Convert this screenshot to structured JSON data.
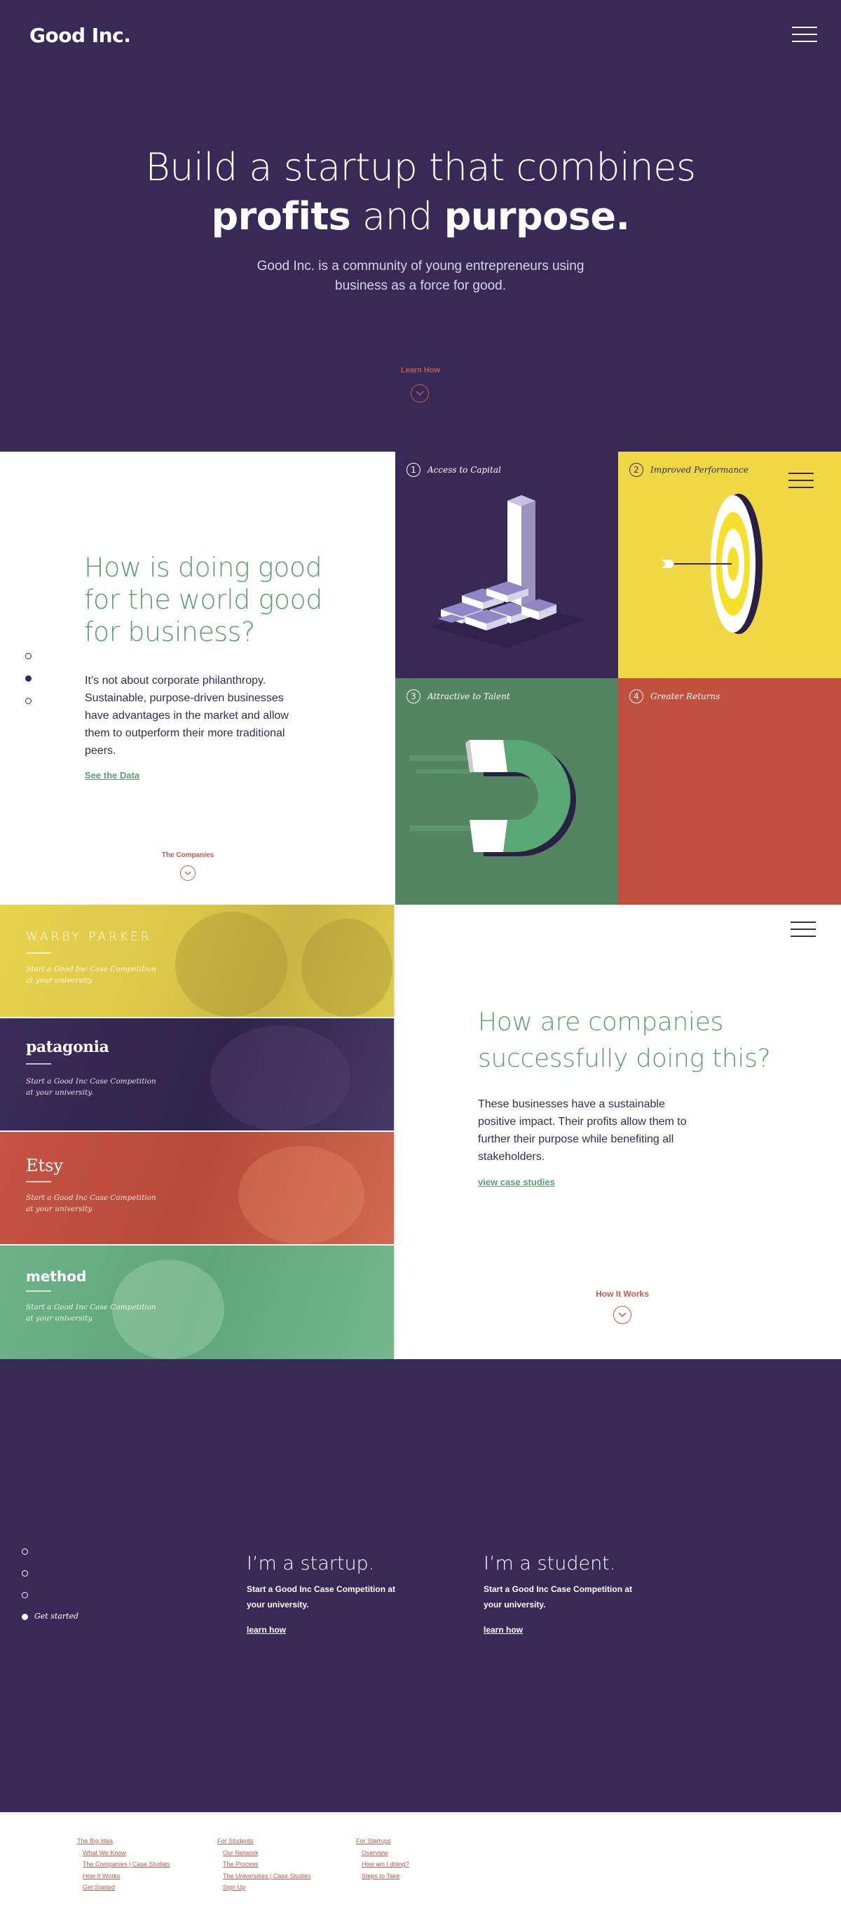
{
  "brand": {
    "logo": "Good Inc."
  },
  "colors": {
    "purple": "#372a57",
    "green": "#5a9f72",
    "yellow": "#f0d744",
    "red": "#c25040",
    "coral": "#c25a48"
  },
  "hero": {
    "title_line1": "Build a startup that combines",
    "title_strong1": "profits",
    "title_mid": "and",
    "title_strong2": "purpose.",
    "subtitle": "Good Inc. is a community of young entrepreneurs using business as a force for good.",
    "cta": "Learn How"
  },
  "why": {
    "title": "How is doing good for the world good for business?",
    "body": "It’s not about corporate philanthropy. Sustainable, purpose-driven businesses have advantages in the market and allow them to outperform their more traditional peers.",
    "link": "See the Data",
    "next": "The Companies",
    "tiles": [
      {
        "num": "1",
        "label": "Access to Capital",
        "icon": "stairs-bar-chart-icon"
      },
      {
        "num": "2",
        "label": "Improved Performance",
        "icon": "target-arrow-icon"
      },
      {
        "num": "3",
        "label": "Attractive to Talent",
        "icon": "magnet-icon"
      },
      {
        "num": "4",
        "label": "Greater Returns",
        "icon": ""
      }
    ]
  },
  "companies": {
    "brands": [
      {
        "name": "WARBY PARKER",
        "tagline": "Start a Good Inc Case Competition at your university."
      },
      {
        "name": "patagonia",
        "tagline": "Start a Good Inc Case Competition at your university."
      },
      {
        "name": "Etsy",
        "tagline": "Start a Good Inc Case Competition at your university."
      },
      {
        "name": "method",
        "tagline": "Start a Good Inc Case Competition at your university."
      }
    ],
    "title": "How are companies successfully doing this?",
    "body": "These businesses have a sustainable positive impact. Their profits allow them to further their purpose while benefiting all stakeholders.",
    "link": "view case studies",
    "next": "How It Works"
  },
  "getstarted": {
    "nav_label": "Get started",
    "cards": [
      {
        "title": "I’m a startup.",
        "body": "Start a Good Inc Case Competition at your university.",
        "link": "learn how"
      },
      {
        "title": "I’m a student.",
        "body": "Start a Good Inc Case Competition at your university.",
        "link": "learn how"
      }
    ]
  },
  "footer": {
    "columns": [
      {
        "heading": "The Big Idea",
        "links": [
          "What We Know",
          "The Companies  |  Case Studies",
          "How It Works",
          "Get Started"
        ]
      },
      {
        "heading": "For Students",
        "links": [
          "Our Network",
          "The Process",
          "The Universities  |  Case Studies",
          "Sign Up"
        ]
      },
      {
        "heading": "For Startups",
        "links": [
          "Overview",
          "How am I doing?",
          "Steps to Take"
        ]
      }
    ]
  }
}
